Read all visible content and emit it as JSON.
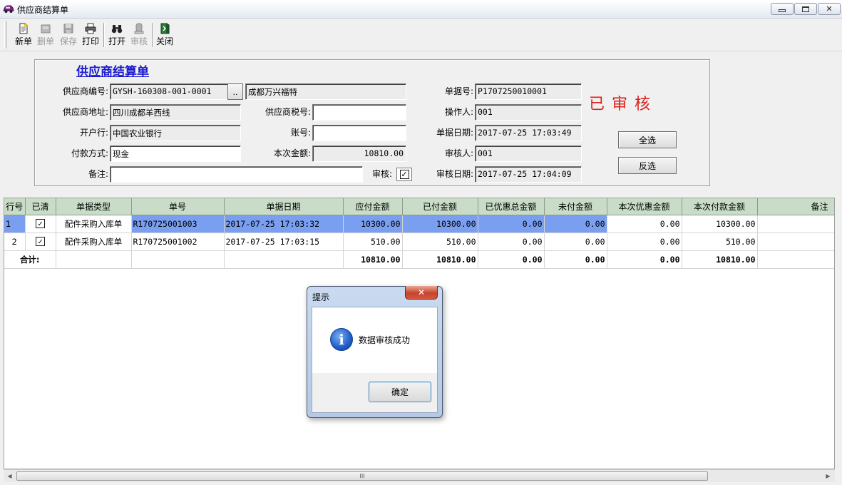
{
  "window": {
    "title": "供应商结算单",
    "min_glyph": "▭",
    "max_glyph": "◘",
    "close_glyph": "✕"
  },
  "toolbar": {
    "items": [
      {
        "label": "新单",
        "icon": "new-doc-icon",
        "enabled": true
      },
      {
        "label": "删单",
        "icon": "delete-doc-icon",
        "enabled": false
      },
      {
        "label": "保存",
        "icon": "save-icon",
        "enabled": false
      },
      {
        "label": "打印",
        "icon": "printer-icon",
        "enabled": true
      },
      {
        "label": "打开",
        "icon": "binoculars-icon",
        "enabled": true
      },
      {
        "label": "审核",
        "icon": "audit-stamp-icon",
        "enabled": false
      },
      {
        "label": "关闭",
        "icon": "exit-door-icon",
        "enabled": true
      }
    ]
  },
  "form": {
    "title": "供应商结算单",
    "supplier_code_label": "供应商编号:",
    "supplier_code": "GYSH-160308-001-0001",
    "ellipsis": "..",
    "supplier_name": "成都万兴福特",
    "doc_no_label": "单据号:",
    "doc_no": "P1707250010001",
    "address_label": "供应商地址:",
    "address": "四川成都羊西线",
    "tax_no_label": "供应商税号:",
    "tax_no": "",
    "operator_label": "操作人:",
    "operator": "001",
    "bank_label": "开户行:",
    "bank": "中国农业银行",
    "account_label": "账号:",
    "account": "",
    "doc_date_label": "单据日期:",
    "doc_date": "2017-07-25 17:03:49",
    "pay_method_label": "付款方式:",
    "pay_method": "现金",
    "amount_label": "本次金额:",
    "amount": "10810.00",
    "auditor_label": "审核人:",
    "auditor": "001",
    "remark_label": "备注:",
    "remark": "",
    "audit_label": "审核:",
    "audit_checked": "✓",
    "audit_date_label": "审核日期:",
    "audit_date": "2017-07-25 17:04:09",
    "status_stamp": "已审核",
    "select_all_label": "全选",
    "invert_label": "反选"
  },
  "grid": {
    "columns": [
      "行号",
      "已清",
      "单据类型",
      "单号",
      "单据日期",
      "应付金额",
      "已付金额",
      "已优惠总金额",
      "未付金额",
      "本次优惠金额",
      "本次付款金额",
      "备注"
    ],
    "rows": [
      {
        "no": "1",
        "cleared": "✓",
        "type": "配件采购入库单",
        "doc": "R170725001003",
        "date": "2017-07-25 17:03:32",
        "payable": "10300.00",
        "paid": "10300.00",
        "discount_total": "0.00",
        "unpaid": "0.00",
        "this_discount": "0.00",
        "this_payment": "10300.00",
        "remark": ""
      },
      {
        "no": "2",
        "cleared": "✓",
        "type": "配件采购入库单",
        "doc": "R170725001002",
        "date": "2017-07-25 17:03:15",
        "payable": "510.00",
        "paid": "510.00",
        "discount_total": "0.00",
        "unpaid": "0.00",
        "this_discount": "0.00",
        "this_payment": "510.00",
        "remark": ""
      }
    ],
    "total": {
      "label": "合计:",
      "payable": "10810.00",
      "paid": "10810.00",
      "discount_total": "0.00",
      "unpaid": "0.00",
      "this_discount": "0.00",
      "this_payment": "10810.00"
    },
    "scroll_left": "◀",
    "scroll_right": "▶",
    "scroll_grip": "III"
  },
  "dialog": {
    "title": "提示",
    "close_glyph": "✕",
    "icon_glyph": "i",
    "message": "数据审核成功",
    "ok_label": "确定"
  },
  "colors": {
    "selected_row": "#7a9ef0",
    "header_bg": "#c8dcc8",
    "stamp": "#e0201c",
    "form_title": "#1a1acf"
  }
}
